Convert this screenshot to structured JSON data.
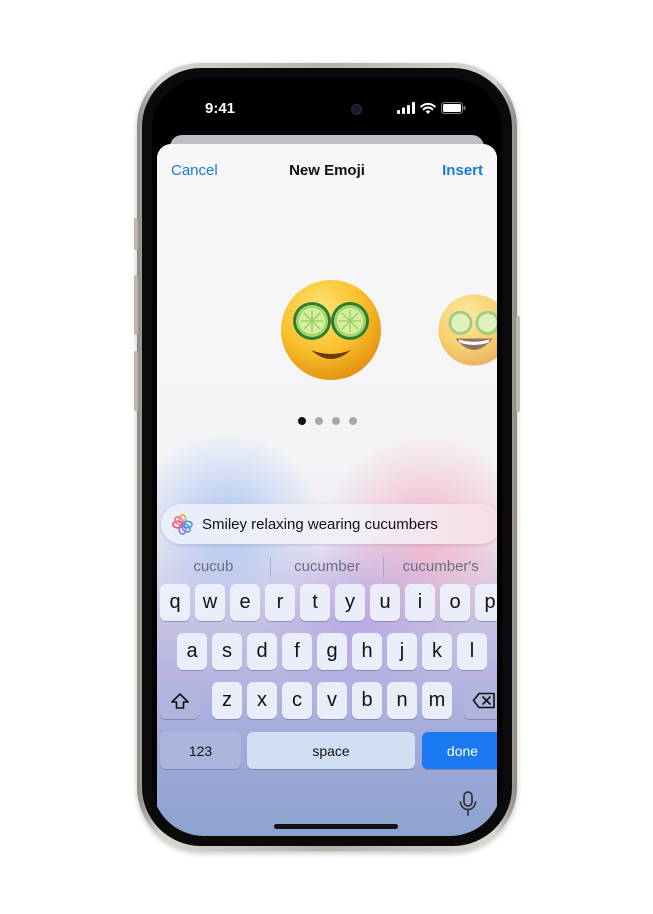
{
  "status_bar": {
    "time": "9:41"
  },
  "nav": {
    "cancel": "Cancel",
    "title": "New Emoji",
    "insert": "Insert"
  },
  "emoji_variants": [
    {
      "name": "smiley-cucumber-eyes",
      "selected": true
    },
    {
      "name": "smiley-cucumber-eyes-grin",
      "selected": false
    }
  ],
  "page_indicator": {
    "count": 4,
    "current": 1
  },
  "prompt": {
    "text": "Smiley relaxing wearing cucumbers",
    "icon": "image-playground-icon"
  },
  "suggestions": [
    "cucub",
    "cucumber",
    "cucumber's"
  ],
  "keyboard": {
    "row1": [
      "q",
      "w",
      "e",
      "r",
      "t",
      "y",
      "u",
      "i",
      "o",
      "p"
    ],
    "row2": [
      "a",
      "s",
      "d",
      "f",
      "g",
      "h",
      "j",
      "k",
      "l"
    ],
    "row3": [
      "z",
      "x",
      "c",
      "v",
      "b",
      "n",
      "m"
    ],
    "numbers": "123",
    "space": "space",
    "done": "done",
    "shift_icon": "shift-icon",
    "delete_icon": "delete-icon",
    "mic_icon": "microphone-icon"
  },
  "colors": {
    "accent": "#1a78d6",
    "done_key": "#1a78f0"
  }
}
